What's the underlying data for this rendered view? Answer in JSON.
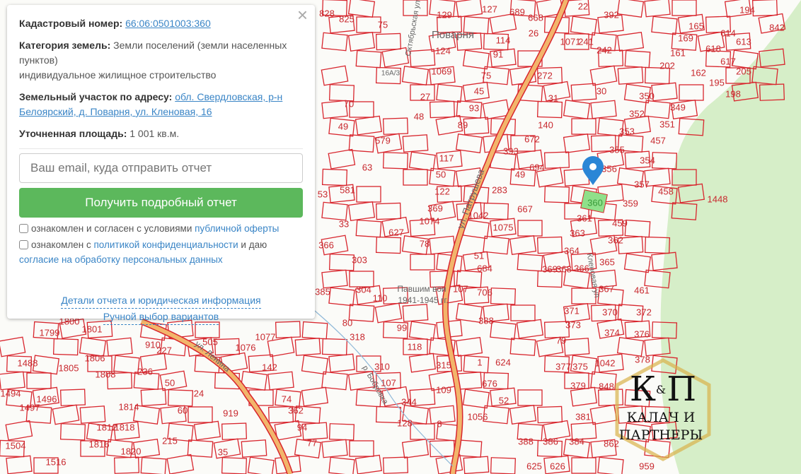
{
  "panel": {
    "cadastral_label": "Кадастровый номер:",
    "cadastral_number": "66:06:0501003:360",
    "category_label": "Категория земель:",
    "category_value": "Земли поселений (земли населенных пунктов)",
    "usage": "индивидуальное жилищное строительство",
    "address_label": "Земельный участок по адресу:",
    "address_value": "обл. Свердловская, р-н Белоярский, д. Поварня, ул. Кленовая, 16",
    "area_label": "Уточненная площадь:",
    "area_value": "1 001 кв.м.",
    "email_placeholder": "Ваш email, куда отправить отчет",
    "submit_label": "Получить подробный отчет",
    "check1_text": "ознакомлен и согласен с условиями",
    "check1_link": "публичной оферты",
    "check2_text": "ознакомлен с",
    "check2_link": "политикой конфиденциальности",
    "check2_mid": "и даю",
    "check2_link2": "согласие на обработку персональных данных",
    "details_link": "Детали отчета и юридическая информация",
    "manual_link": "Ручной выбор вариантов",
    "close": "×"
  },
  "map": {
    "parcel_labels": [
      "828",
      "825",
      "75",
      "129",
      "127",
      "689",
      "668",
      "26",
      "22",
      "392",
      "1071",
      "241",
      "242",
      "114",
      "124",
      "91",
      "1069",
      "75",
      "272",
      "30",
      "45",
      "27",
      "93",
      "31",
      "48",
      "89",
      "140",
      "70",
      "49",
      "579",
      "672",
      "393",
      "694",
      "117",
      "49",
      "50",
      "283",
      "667",
      "122",
      "369",
      "1042",
      "1075",
      "1074",
      "63",
      "581",
      "53",
      "33",
      "627",
      "78",
      "366",
      "303",
      "51",
      "684",
      "385",
      "304",
      "110",
      "706",
      "107",
      "80",
      "318",
      "388",
      "99",
      "118",
      "315",
      "310",
      "107",
      "1",
      "624",
      "676",
      "109",
      "344",
      "52",
      "128",
      "8",
      "1056",
      "366",
      "369",
      "368",
      "364",
      "363",
      "361",
      "360",
      "362",
      "365",
      "367",
      "461",
      "370",
      "372",
      "371",
      "373",
      "374",
      "376",
      "79",
      "377",
      "375",
      "379",
      "1042",
      "378",
      "848",
      "381",
      "388",
      "386",
      "384",
      "862",
      "625",
      "626",
      "959",
      "359",
      "459",
      "458",
      "357",
      "354",
      "355",
      "356",
      "353",
      "352",
      "350",
      "349",
      "351",
      "457",
      "1448",
      "165",
      "169",
      "161",
      "202",
      "162",
      "195",
      "198",
      "618",
      "614",
      "617",
      "613",
      "205",
      "194",
      "842",
      "1800",
      "1799",
      "1801",
      "1805",
      "1806",
      "1808",
      "1488",
      "1494",
      "1497",
      "1496",
      "1814",
      "1812",
      "1816",
      "1820",
      "1818",
      "50",
      "24",
      "60",
      "215",
      "35",
      "362",
      "94",
      "74",
      "77",
      "919",
      "1504",
      "1516",
      "910",
      "505",
      "1076",
      "1077",
      "142",
      "236",
      "227"
    ],
    "place_labels": [
      "Поварня",
      "ул. Патрушева",
      "ул. Ленина",
      "р. Бобровка",
      "Кленовая ул",
      "Октябрьская ул",
      "Павшим вои",
      "1941-1945 гг.",
      "16А/3"
    ],
    "selected_parcel": "360",
    "colors": {
      "parcel": "#d8262e",
      "road": "#f2b56b",
      "forest": "#d6eec8",
      "selected": "#8fe08a",
      "marker": "#2a86d6"
    }
  },
  "logo": {
    "mark": "К&П",
    "line1": "КАЛАЧ И",
    "line2": "ПАРТНЕРЫ"
  }
}
